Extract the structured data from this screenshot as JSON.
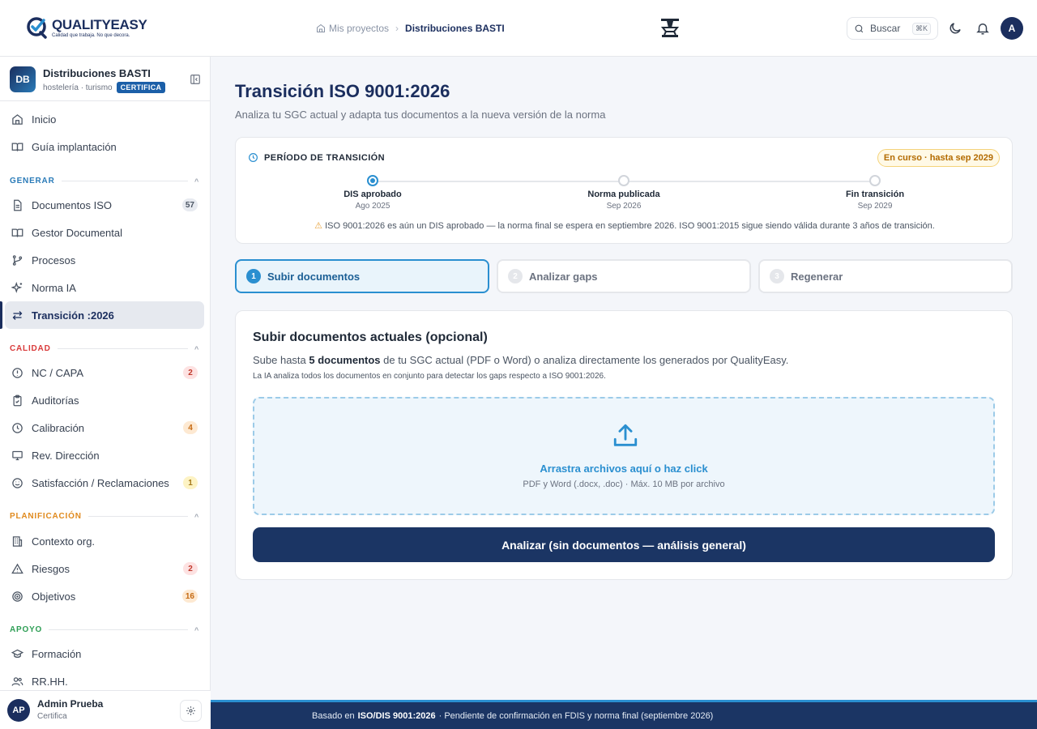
{
  "header": {
    "logo_name": "QUALITYEASY",
    "logo_tagline": "Calidad que trabaja. No que decora.",
    "breadcrumb_home": "Mis proyectos",
    "breadcrumb_current": "Distribuciones BASTI",
    "search_label": "Buscar",
    "search_shortcut": "⌘K",
    "user_initial": "A"
  },
  "sidebar": {
    "org": {
      "initials": "DB",
      "name": "Distribuciones BASTI",
      "sector": "hostelería · turismo",
      "plan": "CERTIFICA"
    },
    "top_items": [
      {
        "label": "Inicio",
        "icon": "home-icon"
      },
      {
        "label": "Guía implantación",
        "icon": "book-icon"
      }
    ],
    "sections": [
      {
        "title": "GENERAR",
        "color": "#2a7bb8",
        "items": [
          {
            "label": "Documentos ISO",
            "icon": "file-icon",
            "count": "57"
          },
          {
            "label": "Gestor Documental",
            "icon": "book-icon"
          },
          {
            "label": "Procesos",
            "icon": "git-branch-icon"
          },
          {
            "label": "Norma IA",
            "icon": "sparkle-icon"
          },
          {
            "label": "Transición :2026",
            "icon": "arrows-swap-icon",
            "active": true
          }
        ]
      },
      {
        "title": "CALIDAD",
        "color": "#d93a3a",
        "items": [
          {
            "label": "NC / CAPA",
            "icon": "alert-circle-icon",
            "count": "2"
          },
          {
            "label": "Auditorías",
            "icon": "clipboard-check-icon"
          },
          {
            "label": "Calibración",
            "icon": "clock-icon",
            "count": "4"
          },
          {
            "label": "Rev. Dirección",
            "icon": "monitor-icon"
          },
          {
            "label": "Satisfacción / Reclamaciones",
            "icon": "smile-icon",
            "count": "1"
          }
        ]
      },
      {
        "title": "PLANIFICACIÓN",
        "color": "#e08a1e",
        "items": [
          {
            "label": "Contexto org.",
            "icon": "building-icon"
          },
          {
            "label": "Riesgos",
            "icon": "warning-triangle-icon",
            "count": "2"
          },
          {
            "label": "Objetivos",
            "icon": "target-icon",
            "count": "16"
          }
        ]
      },
      {
        "title": "APOYO",
        "color": "#2e9e55",
        "items": [
          {
            "label": "Formación",
            "icon": "graduation-cap-icon"
          },
          {
            "label": "RR.HH.",
            "icon": "users-icon"
          }
        ]
      }
    ],
    "user": {
      "initials": "AP",
      "name": "Admin Prueba",
      "role": "Certifica"
    }
  },
  "main": {
    "title": "Transición ISO 9001:2026",
    "subtitle": "Analiza tu SGC actual y adapta tus documentos a la nueva versión de la norma",
    "period": {
      "heading": "PERÍODO DE TRANSICIÓN",
      "status": "En curso · hasta sep 2029",
      "milestones": [
        {
          "label": "DIS aprobado",
          "date": "Ago 2025",
          "done": true
        },
        {
          "label": "Norma publicada",
          "date": "Sep 2026",
          "done": false
        },
        {
          "label": "Fin transición",
          "date": "Sep 2029",
          "done": false
        }
      ],
      "warning": "ISO 9001:2026 es aún un DIS aprobado — la norma final se espera en septiembre 2026. ISO 9001:2015 sigue siendo válida durante 3 años de transición."
    },
    "steps": [
      {
        "num": "1",
        "label": "Subir documentos"
      },
      {
        "num": "2",
        "label": "Analizar gaps"
      },
      {
        "num": "3",
        "label": "Regenerar"
      }
    ],
    "upload": {
      "title": "Subir documentos actuales (opcional)",
      "desc_pre": "Sube hasta ",
      "desc_bold": "5 documentos",
      "desc_post": " de tu SGC actual (PDF o Word) o analiza directamente los generados por QualityEasy.",
      "note": "La IA analiza todos los documentos en conjunto para detectar los gaps respecto a ISO 9001:2026.",
      "drop_main": "Arrastra archivos aquí o haz click",
      "drop_sub": "PDF y Word (.docx, .doc) · Máx. 10 MB por archivo",
      "button": "Analizar (sin documentos — análisis general)"
    },
    "footer": {
      "pre": "Basado en ",
      "bold": "ISO/DIS 9001:2026",
      "post": " · Pendiente de confirmación en FDIS y norma final (septiembre 2026)"
    }
  }
}
